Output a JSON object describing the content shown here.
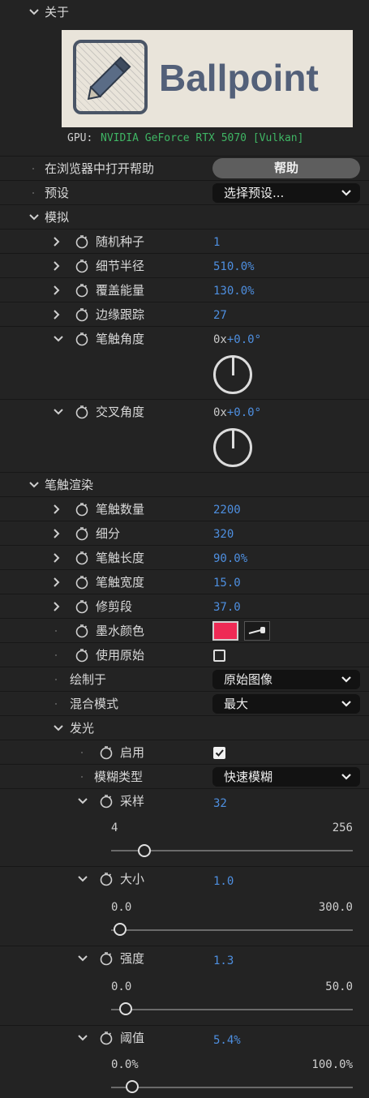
{
  "about": {
    "label": "关于",
    "logo_text": "Ballpoint",
    "gpu_prefix": "GPU:",
    "gpu_value": "NVIDIA GeForce RTX 5070 [Vulkan]"
  },
  "help": {
    "label": "在浏览器中打开帮助",
    "button": "帮助"
  },
  "preset": {
    "label": "预设",
    "value": "选择预设..."
  },
  "simulate": {
    "label": "模拟",
    "random_seed": {
      "label": "随机种子",
      "value": "1"
    },
    "detail_radius": {
      "label": "细节半径",
      "value": "510.0%"
    },
    "coverage_energy": {
      "label": "覆盖能量",
      "value": "130.0%"
    },
    "edge_tracking": {
      "label": "边缘跟踪",
      "value": "27"
    },
    "stroke_angle": {
      "label": "笔触角度",
      "value_prefix": "0x",
      "value": "+0.0°",
      "angle_deg": 0
    },
    "cross_angle": {
      "label": "交叉角度",
      "value_prefix": "0x",
      "value": "+0.0°",
      "angle_deg": 0
    }
  },
  "stroke_render": {
    "label": "笔触渲染",
    "stroke_count": {
      "label": "笔触数量",
      "value": "2200"
    },
    "subdivide": {
      "label": "细分",
      "value": "320"
    },
    "stroke_length": {
      "label": "笔触长度",
      "value": "90.0%"
    },
    "stroke_width": {
      "label": "笔触宽度",
      "value": "15.0"
    },
    "trim_segments": {
      "label": "修剪段",
      "value": "37.0"
    },
    "ink_color": {
      "label": "墨水颜色",
      "color": "#ee2a55"
    },
    "use_original": {
      "label": "使用原始",
      "checked": false
    },
    "draw_on": {
      "label": "绘制于",
      "value": "原始图像"
    },
    "blend_mode": {
      "label": "混合模式",
      "value": "最大"
    }
  },
  "glow": {
    "label": "发光",
    "enable": {
      "label": "启用",
      "checked": true
    },
    "blur_type": {
      "label": "模糊类型",
      "value": "快速模糊"
    },
    "samples": {
      "label": "采样",
      "value": "32",
      "min": "4",
      "max": "256",
      "fraction": 0.11
    },
    "size": {
      "label": "大小",
      "value": "1.0",
      "min": "0.0",
      "max": "300.0",
      "fraction": 0.0
    },
    "intensity": {
      "label": "强度",
      "value": "1.3",
      "min": "0.0",
      "max": "50.0",
      "fraction": 0.026
    },
    "threshold": {
      "label": "阈值",
      "value": "5.4%",
      "min": "0.0%",
      "max": "100.0%",
      "fraction": 0.054
    }
  }
}
